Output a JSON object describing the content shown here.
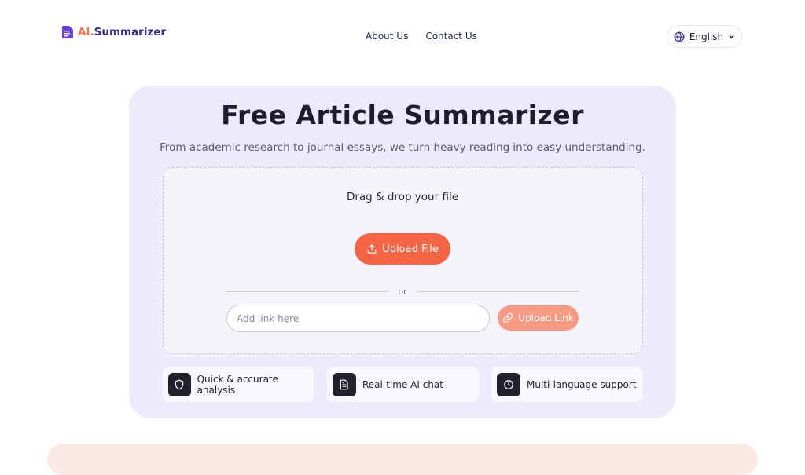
{
  "brand": {
    "ai": "AI.",
    "name": "Summarizer"
  },
  "nav": {
    "about": "About Us",
    "contact": "Contact Us"
  },
  "language": {
    "selected": "English",
    "icon": "globe-icon"
  },
  "hero": {
    "title": "Free Article Summarizer",
    "subtitle": "From academic research to journal essays, we turn heavy reading into easy understanding."
  },
  "upload": {
    "drop_text": "Drag & drop your file",
    "button": "Upload File",
    "or": "or",
    "link_placeholder": "Add link here",
    "link_button": "Upload Link"
  },
  "features": [
    {
      "label": "Quick & accurate analysis",
      "icon": "shield-icon"
    },
    {
      "label": "Real-time AI chat",
      "icon": "document-icon"
    },
    {
      "label": "Multi-language support",
      "icon": "clock-icon"
    }
  ],
  "colors": {
    "accent": "#f46545",
    "brand_purple": "#3d2a8c",
    "hero_bg": "#efeafa"
  }
}
